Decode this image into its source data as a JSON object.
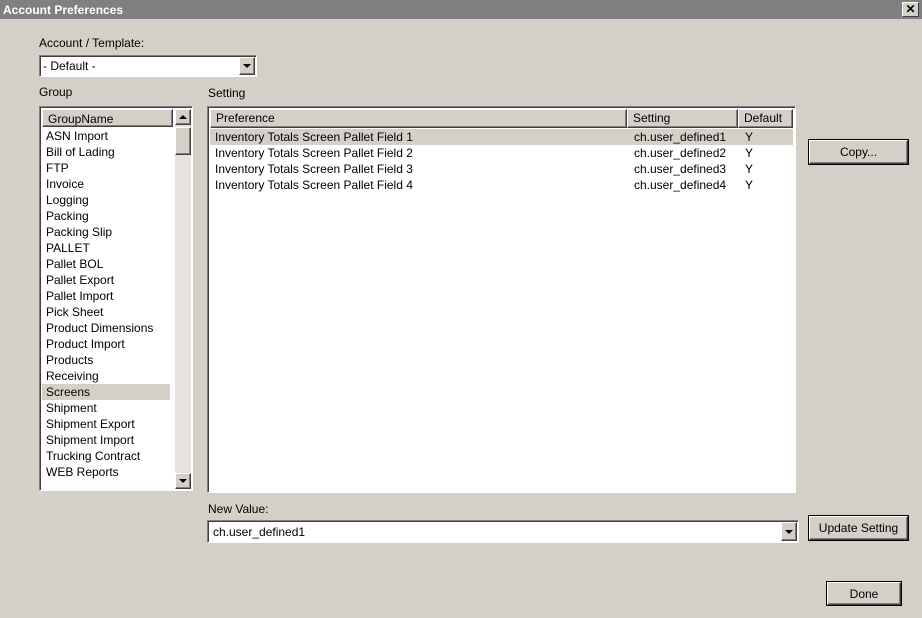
{
  "window": {
    "title": "Account Preferences",
    "close_glyph": "✕"
  },
  "account_template": {
    "label": "Account / Template:",
    "value": "- Default -"
  },
  "group": {
    "label": "Group",
    "column_header": "GroupName",
    "items": [
      "ASN Import",
      "Bill of Lading",
      "FTP",
      "Invoice",
      "Logging",
      "Packing",
      "Packing Slip",
      "PALLET",
      "Pallet BOL",
      "Pallet Export",
      "Pallet Import",
      "Pick Sheet",
      "Product Dimensions",
      "Product Import",
      "Products",
      "Receiving",
      "Screens",
      "Shipment",
      "Shipment Export",
      "Shipment Import",
      "Trucking Contract",
      "WEB Reports"
    ],
    "selected": "Screens"
  },
  "setting": {
    "label": "Setting",
    "columns": [
      "Preference",
      "Setting",
      "Default"
    ],
    "rows": [
      [
        "Inventory Totals Screen Pallet Field 1",
        "ch.user_defined1",
        "Y"
      ],
      [
        "Inventory Totals Screen Pallet Field 2",
        "ch.user_defined2",
        "Y"
      ],
      [
        "Inventory Totals Screen Pallet Field 3",
        "ch.user_defined3",
        "Y"
      ],
      [
        "Inventory Totals Screen Pallet Field 4",
        "ch.user_defined4",
        "Y"
      ]
    ],
    "selected_row": 0
  },
  "new_value": {
    "label": "New Value:",
    "value": "ch.user_defined1"
  },
  "buttons": {
    "copy": "Copy...",
    "update_setting": "Update Setting",
    "done": "Done"
  }
}
